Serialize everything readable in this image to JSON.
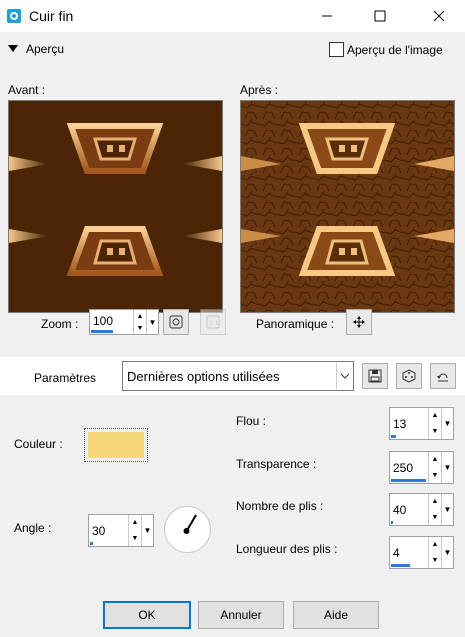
{
  "window": {
    "title": "Cuir fin",
    "icon": "app-icon",
    "minimize_icon": "minimize-icon",
    "maximize_icon": "maximize-icon",
    "close_icon": "close-icon"
  },
  "preview": {
    "toggle_label": "Aperçu",
    "image_preview_label": "Aperçu de l'image",
    "before_label": "Avant :",
    "after_label": "Après :"
  },
  "zoom": {
    "label": "Zoom :",
    "value": "100",
    "level_fraction": 0.5
  },
  "pan": {
    "label": "Panoramique :"
  },
  "params": {
    "label": "Paramètres",
    "preset_value": "Dernières options utilisées"
  },
  "color": {
    "label": "Couleur :",
    "swatch": "#f7d67a"
  },
  "angle": {
    "label": "Angle :",
    "value": "30",
    "level_fraction": 0.08
  },
  "blur": {
    "label": "Flou :",
    "value": "13",
    "level_fraction": 0.13
  },
  "transparency": {
    "label": "Transparence :",
    "value": "250",
    "level_fraction": 0.98
  },
  "folds": {
    "label": "Nombre de plis :",
    "value": "40",
    "level_fraction": 0.04
  },
  "fold_length": {
    "label": "Longueur des plis :",
    "value": "4",
    "level_fraction": 0.4
  },
  "buttons": {
    "ok": "OK",
    "cancel": "Annuler",
    "help": "Aide"
  },
  "colors": {
    "accent": "#0078d7",
    "image_dark": "#4a2405",
    "image_light": "#f3c17a"
  }
}
